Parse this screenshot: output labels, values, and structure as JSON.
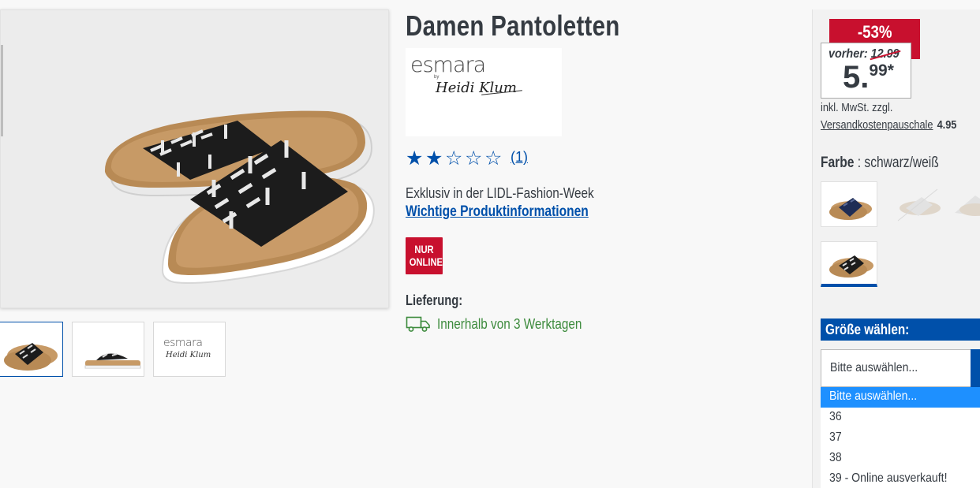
{
  "product": {
    "title": "Damen Pantoletten",
    "brand": {
      "name": "esmara",
      "by": "by",
      "signature": "Heidi Klum"
    },
    "rating": {
      "stars_filled": 2,
      "stars_total": 5,
      "count_label": "(1)"
    },
    "tagline": "Exklusiv in der LIDL-Fashion-Week",
    "info_link": "Wichtige Produktinformationen",
    "online_badge": {
      "line1": "NUR",
      "line2": "ONLINE"
    },
    "delivery": {
      "label": "Lieferung:",
      "text": "Innerhalb von 3 Werktagen"
    }
  },
  "gallery": {
    "thumb_logo": "esmara",
    "thumb_sign": "Heidi Klum"
  },
  "pricing": {
    "discount": "-53%",
    "old_label": "vorher:",
    "old_price": "12.99",
    "price_main": "5.",
    "price_cents": "99*",
    "vat_text": "inkl. MwSt. zzgl.",
    "shipping_link": "Versandkostenpauschale",
    "shipping_amount": "4.95"
  },
  "color": {
    "label": "Farbe",
    "separator": " : ",
    "value": "schwarz/weiß"
  },
  "size": {
    "header": "Größe wählen:",
    "selected": "Bitte auswählen...",
    "options": [
      "Bitte auswählen...",
      "36",
      "37",
      "38",
      "39 - Online ausverkauft!"
    ]
  },
  "colors": {
    "accent_blue": "#0050aa",
    "sale_red": "#c8102e",
    "delivery_green": "#3d8b3d",
    "highlight_blue": "#1e90ff"
  }
}
